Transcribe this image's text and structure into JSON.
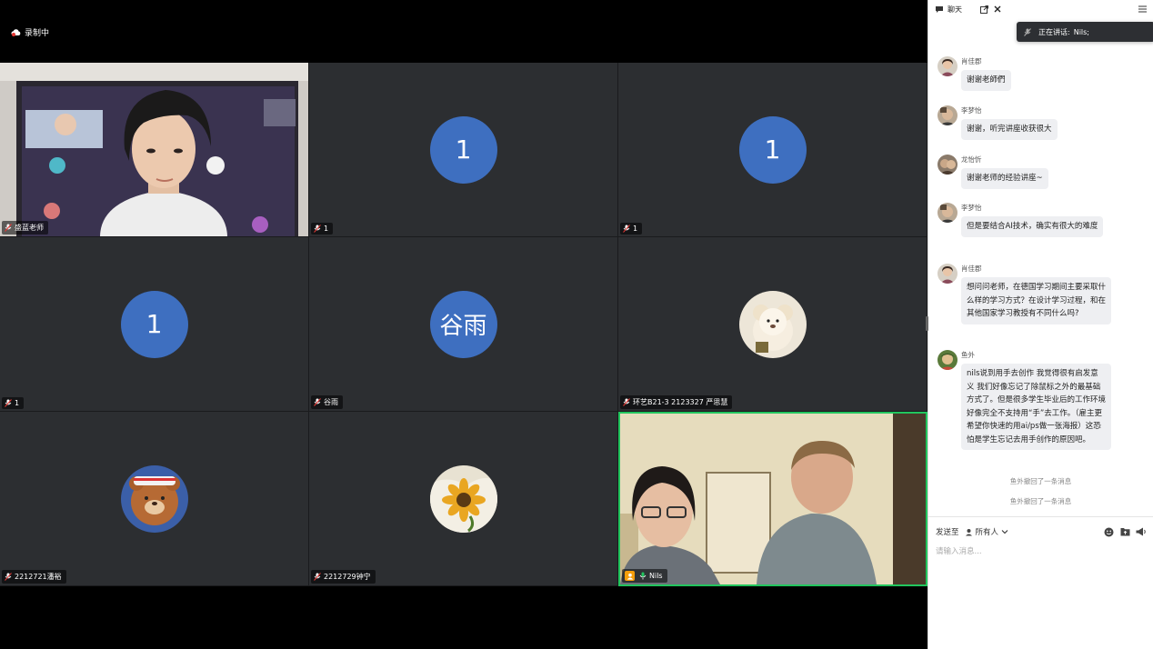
{
  "recording": {
    "label": "录制中"
  },
  "tiles": [
    {
      "id": "t1",
      "name": "盛蓝老师",
      "kind": "video"
    },
    {
      "id": "t2",
      "name": "1",
      "avatar_text": "1",
      "kind": "initial"
    },
    {
      "id": "t3",
      "name": "1",
      "avatar_text": "1",
      "kind": "initial"
    },
    {
      "id": "t4",
      "name": "1",
      "avatar_text": "1",
      "kind": "initial"
    },
    {
      "id": "t5",
      "name": "谷雨",
      "avatar_text": "谷雨",
      "kind": "initial"
    },
    {
      "id": "t6",
      "name": "环艺B21-3 2123327 严思慧",
      "kind": "photo"
    },
    {
      "id": "t7",
      "name": "2212721潘裕",
      "kind": "photo"
    },
    {
      "id": "t8",
      "name": "2212729钟宁",
      "kind": "photo"
    },
    {
      "id": "t9",
      "name": "Nils",
      "kind": "video",
      "active": true
    }
  ],
  "chat": {
    "title": "聊天",
    "speaking_label": "正在讲话:",
    "speaking_name": "Nils;",
    "messages": [
      {
        "sender": "肖佳郡",
        "text": "谢谢老師們"
      },
      {
        "sender": "李梦怡",
        "text": "谢谢，听完讲座收获很大"
      },
      {
        "sender": "龙怡忻",
        "text": "谢谢老师的经验讲座~"
      },
      {
        "sender": "李梦怡",
        "text": "但是要结合AI技术，确实有很大的难度"
      },
      {
        "sender": "肖佳郡",
        "text": "想问问老师，在德国学习期间主要采取什么样的学习方式？在设计学习过程，和在其他国家学习教授有不同什么吗?"
      },
      {
        "sender": "鱼外",
        "text": "nils说到用手去创作 我觉得很有启发意义 我们好像忘记了除鼠标之外的最基础方式了。但是很多学生毕业后的工作环境好像完全不支持用“手”去工作。（雇主更希望你快速的用ai/ps做一张海报）这恐怕是学生忘记去用手创作的原因吧。"
      }
    ],
    "system_messages": [
      "鱼外撤回了一条消息",
      "鱼外撤回了一条消息"
    ],
    "send_to_label": "发送至",
    "recipient": "所有人",
    "input_placeholder": "请输入消息..."
  },
  "colors": {
    "accent_blue": "#3e6fc0",
    "active_border": "#22c55e",
    "tile_bg": "#2c2e31"
  }
}
